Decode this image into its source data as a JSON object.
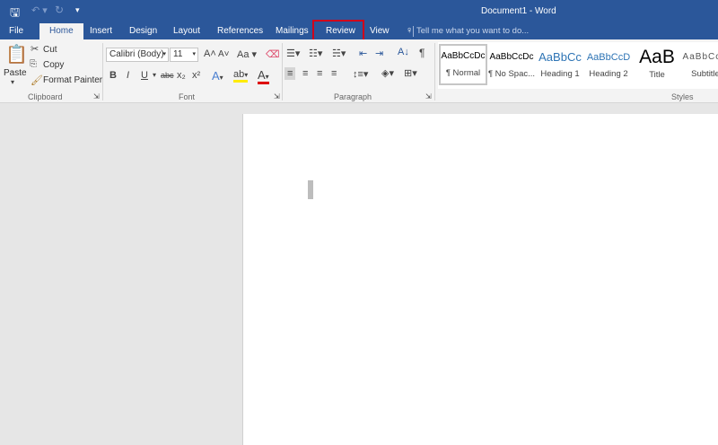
{
  "window": {
    "title": "Document1 - Word"
  },
  "qat": {
    "save": "save-icon",
    "undo": "undo-icon",
    "redo": "redo-icon",
    "customize": "▾"
  },
  "tabs": [
    "File",
    "Home",
    "Insert",
    "Design",
    "Layout",
    "References",
    "Mailings",
    "Review",
    "View"
  ],
  "tell_me": "Tell me what you want to do...",
  "clipboard": {
    "paste": "Paste",
    "cut": "Cut",
    "copy": "Copy",
    "format_painter": "Format Painter",
    "label": "Clipboard"
  },
  "font": {
    "name": "Calibri (Body)",
    "size": "11",
    "change_case": "Aa",
    "bold": "B",
    "italic": "I",
    "underline": "U",
    "strike": "abc",
    "sub": "x₂",
    "sup": "x²",
    "label": "Font"
  },
  "paragraph": {
    "label": "Paragraph",
    "pilcrow": "¶"
  },
  "styles": {
    "label": "Styles",
    "items": [
      {
        "preview": "AaBbCcDc",
        "name": "¶ Normal"
      },
      {
        "preview": "AaBbCcDc",
        "name": "¶ No Spac..."
      },
      {
        "preview": "AaBbCc",
        "name": "Heading 1"
      },
      {
        "preview": "AaBbCcD",
        "name": "Heading 2"
      },
      {
        "preview": "AaB",
        "name": "Title"
      },
      {
        "preview": "AaBbCcD",
        "name": "Subtitle"
      }
    ]
  },
  "colors": {
    "accent": "#2b579a",
    "highlight": "#d0021b"
  }
}
